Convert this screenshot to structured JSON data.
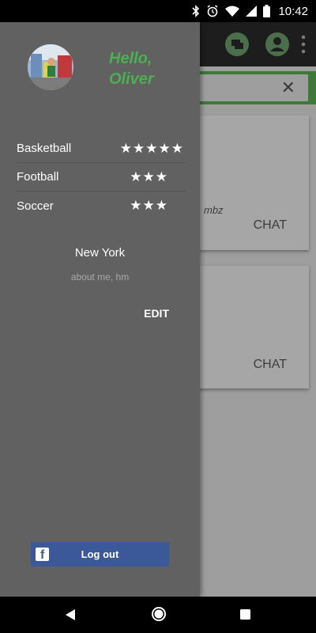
{
  "status_bar": {
    "time": "10:42",
    "icons": [
      "bluetooth-icon",
      "alarm-icon",
      "wifi-icon",
      "signal-icon",
      "battery-icon"
    ]
  },
  "background_app": {
    "toolbar_icons": [
      "chat-bubbles-icon",
      "account-icon",
      "more-vert-icon"
    ],
    "search_clear_icon": "close-icon",
    "cards": [
      {
        "fragment": "mbz",
        "action": "CHAT"
      },
      {
        "fragment": "",
        "action": "CHAT"
      }
    ]
  },
  "drawer": {
    "greeting": "Hello, Oliver",
    "greeting_color": "#4caf50",
    "sports": [
      {
        "name": "Basketball",
        "rating": 5,
        "stars": "★★★★★"
      },
      {
        "name": "Football",
        "rating": 3,
        "stars": "★★★"
      },
      {
        "name": "Soccer",
        "rating": 3,
        "stars": "★★★"
      }
    ],
    "city": "New York",
    "about": "about me, hm",
    "edit_label": "EDIT",
    "logout_label": "Log out",
    "logout_color": "#3b5998"
  },
  "nav_bar": {
    "buttons": [
      "back-icon",
      "home-icon",
      "recents-icon"
    ]
  }
}
